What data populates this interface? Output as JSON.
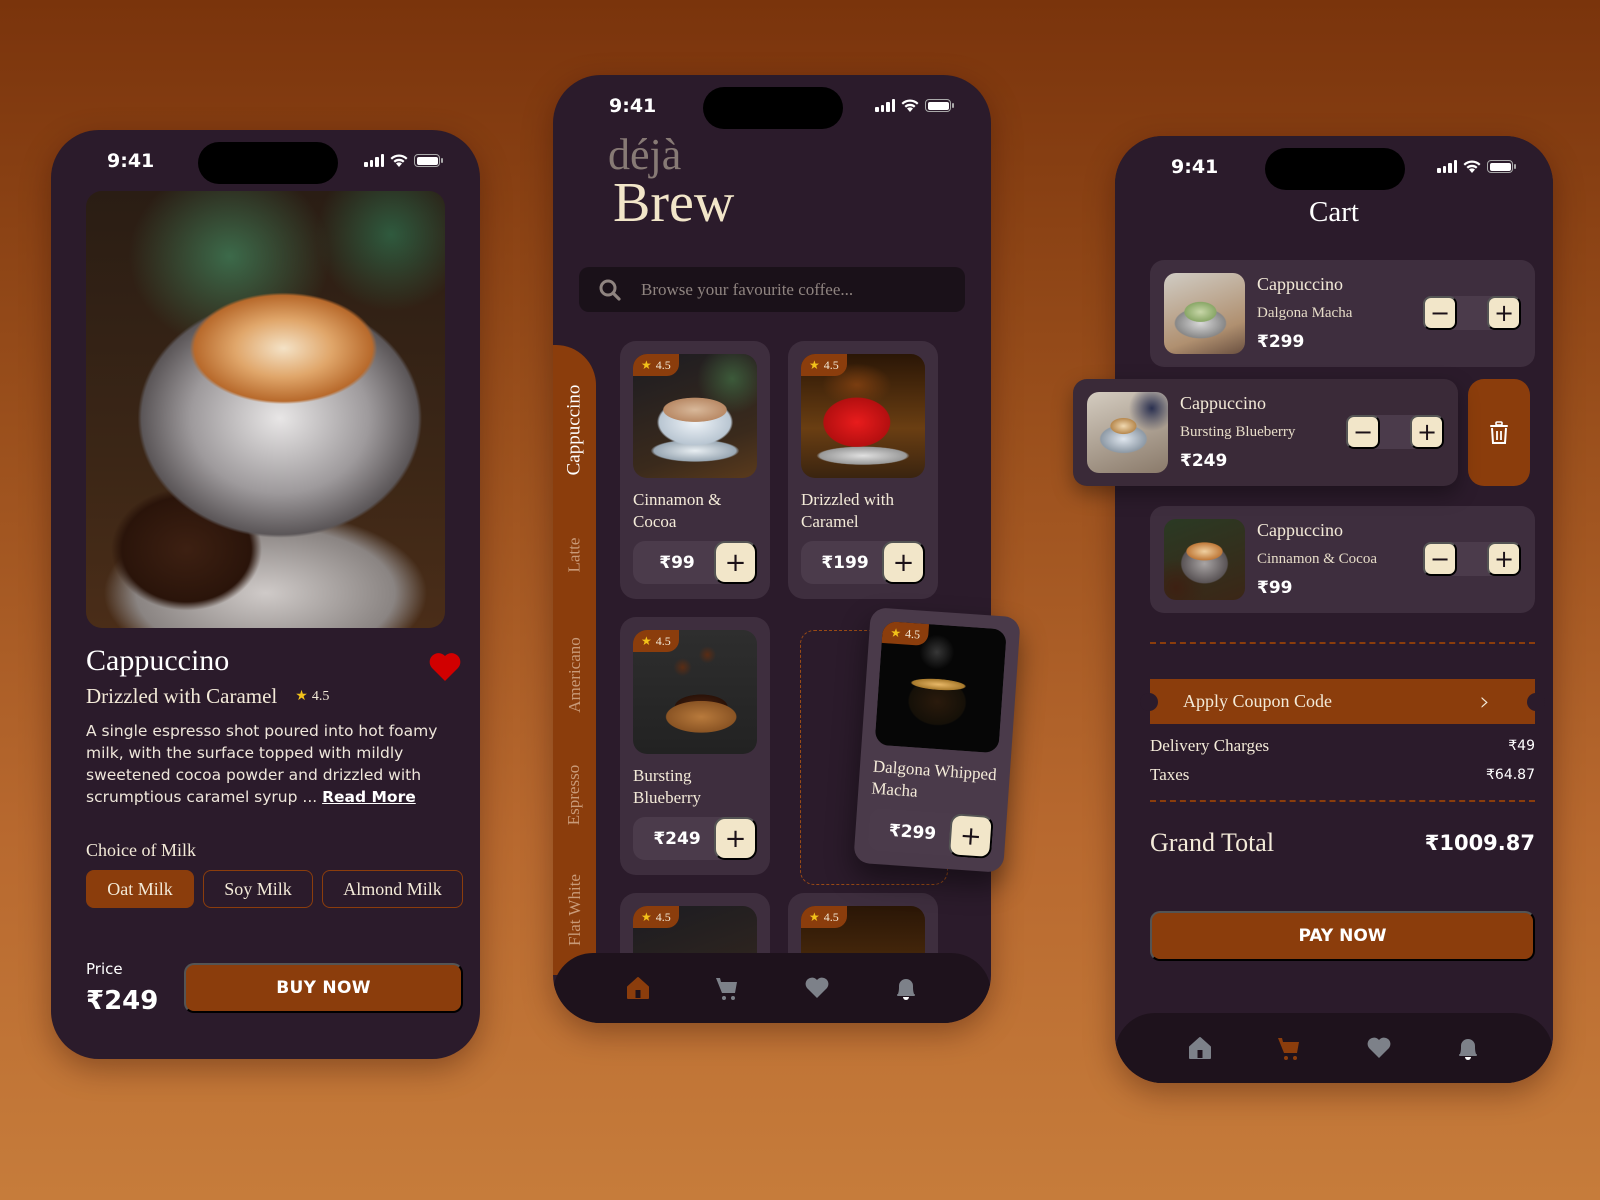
{
  "status_bar": {
    "time": "9:41"
  },
  "colors": {
    "accent": "#8b3d0c",
    "panel": "#2b1b2b",
    "card": "#3e2e3e",
    "cream": "#f2e6c9",
    "star": "#f2c21a",
    "favorite": "#d10000",
    "nav_inactive": "#7d8189"
  },
  "detail_screen": {
    "title": "Cappuccino",
    "subtitle": "Drizzled with Caramel",
    "rating": "4.5",
    "favorite": true,
    "description": "A single espresso shot poured into hot foamy milk, with the surface topped with mildly sweetened cocoa powder and drizzled with scrumptious caramel syrup ... ",
    "read_more": "Read More",
    "milk_label": "Choice of Milk",
    "milk_options": [
      {
        "label": "Oat Milk",
        "selected": true
      },
      {
        "label": "Soy Milk",
        "selected": false
      },
      {
        "label": "Almond Milk",
        "selected": false
      }
    ],
    "price_label": "Price",
    "price": "₹249",
    "buy_label": "BUY NOW"
  },
  "home_screen": {
    "logo_top": "déjà",
    "logo_bottom": "Brew",
    "search_placeholder": "Browse your favourite coffee...",
    "categories": [
      {
        "label": "Cappuccino",
        "active": true
      },
      {
        "label": "Latte",
        "active": false
      },
      {
        "label": "Americano",
        "active": false
      },
      {
        "label": "Espresso",
        "active": false
      },
      {
        "label": "Flat White",
        "active": false
      }
    ],
    "products": [
      {
        "name": "Cinnamon & Cocoa",
        "price": "₹99",
        "rating": "4.5"
      },
      {
        "name": "Drizzled with Caramel",
        "price": "₹199",
        "rating": "4.5"
      },
      {
        "name": "Bursting Blueberry",
        "price": "₹249",
        "rating": "4.5"
      },
      {
        "name": "Dalgona Whipped Macha",
        "price": "₹299",
        "rating": "4.5",
        "dragging": true
      },
      {
        "name": "",
        "price": "",
        "rating": "4.5"
      },
      {
        "name": "",
        "price": "",
        "rating": "4.5"
      }
    ],
    "add_symbol": "+",
    "nav": {
      "active": "home",
      "items": [
        "home",
        "cart",
        "favorites",
        "notifications"
      ]
    }
  },
  "cart_screen": {
    "title": "Cart",
    "items": [
      {
        "name": "Cappuccino",
        "variant": "Dalgona Macha",
        "price": "₹299"
      },
      {
        "name": "Cappuccino",
        "variant": "Bursting Blueberry",
        "price": "₹249",
        "swiped": true
      },
      {
        "name": "Cappuccino",
        "variant": "Cinnamon & Cocoa",
        "price": "₹99"
      }
    ],
    "minus_symbol": "−",
    "plus_symbol": "+",
    "coupon_label": "Apply Coupon Code",
    "coupon_arrow": "›",
    "delivery_label": "Delivery Charges",
    "delivery_value": "₹49",
    "taxes_label": "Taxes",
    "taxes_value": "₹64.87",
    "grand_total_label": "Grand Total",
    "grand_total_value": "₹1009.87",
    "pay_label": "PAY NOW",
    "nav": {
      "active": "cart",
      "items": [
        "home",
        "cart",
        "favorites",
        "notifications"
      ]
    }
  }
}
